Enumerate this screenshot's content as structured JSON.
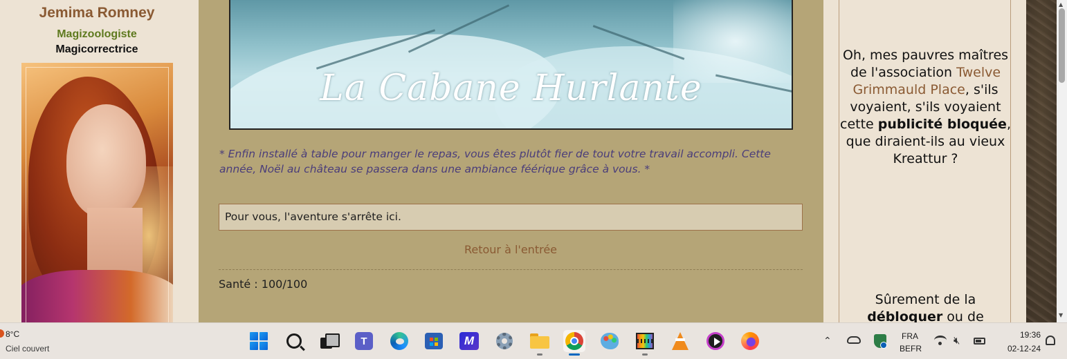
{
  "character": {
    "name": "Jemima Romney",
    "role1": "Magizoologiste",
    "role2": "Magicorrectrice"
  },
  "scene": {
    "banner_title": "La Cabane Hurlante",
    "narration": "* Enfin installé à table pour manger le repas, vous êtes plutôt fier de tout votre travail accompli. Cette année, Noël au château se passera dans une ambiance féérique grâce à vous. *",
    "outcome": "Pour vous, l'aventure s'arrête ici.",
    "return_link": "Retour à l'entrée",
    "health": "Santé : 100/100"
  },
  "adblock": {
    "line1": "Oh, mes pauvres maîtres de l'association ",
    "link": "Twelve Grimmauld Place",
    "line2": ", s'ils voyaient, s'ils voyaient cette ",
    "bold": "publicité bloquée",
    "line3": ", que diraient-ils au vieux Kreattur ?",
    "cont1": "Sûrement de la ",
    "cont_bold": "débloquer",
    "cont2": " ou de"
  },
  "taskbar": {
    "weather_temp": "8°C",
    "weather_desc": "Ciel couvert",
    "apps": [
      "start",
      "search",
      "task-view",
      "teams",
      "edge",
      "store",
      "copilot",
      "settings",
      "file-explorer",
      "chrome",
      "paint",
      "photos",
      "vlc",
      "media-player",
      "firefox"
    ],
    "lang1": "FRA",
    "lang2": "BEFR",
    "time": "19:36",
    "date": "02-12-24"
  },
  "colors": {
    "page_bg": "#ede3d4",
    "content_bg": "#b5a577",
    "link": "#8a5a33",
    "narration": "#4a3d7a",
    "role1": "#5f7a1f"
  }
}
